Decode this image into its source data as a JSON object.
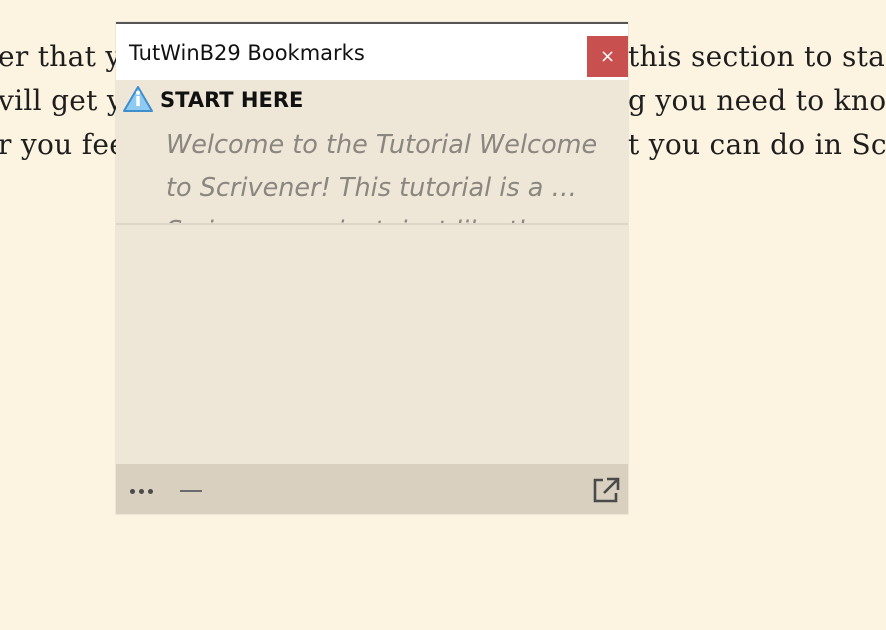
{
  "background_text": {
    "line1_left": "er that y",
    "line1_right": "this section to sta",
    "line2_left": "vill get y",
    "line2_right": "g you need to kno",
    "line3_left": "r you fee",
    "line3_right": "t you can do in Sc"
  },
  "window": {
    "title": "TutWinB29 Bookmarks",
    "close_label": "×"
  },
  "bookmark": {
    "icon": "info-warning-icon",
    "title": "START HERE",
    "preview": "Welcome to the Tutorial Welcome to Scrivener! This tutorial is a … Scrivener project, just like the one"
  },
  "footer": {
    "more_icon": "more-icon",
    "minimize_icon": "minimize-icon",
    "popout_icon": "popout-icon"
  },
  "colors": {
    "background": "#fcf4e1",
    "panel": "#eee6d6",
    "footer": "#d9d0c0",
    "close_button": "#c8514f",
    "icon_blue": "#4aa3df"
  }
}
